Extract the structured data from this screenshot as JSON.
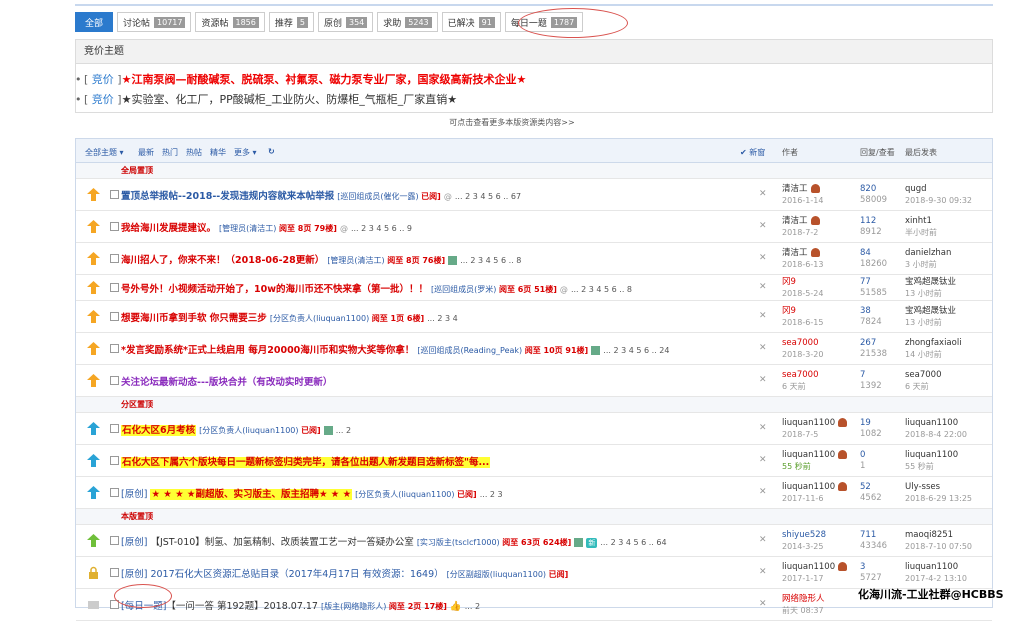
{
  "filters": [
    {
      "label": "全部",
      "count": ""
    },
    {
      "label": "讨论帖",
      "count": "10717"
    },
    {
      "label": "资源帖",
      "count": "1856"
    },
    {
      "label": "推荐",
      "count": "5"
    },
    {
      "label": "原创",
      "count": "354"
    },
    {
      "label": "求助",
      "count": "5243"
    },
    {
      "label": "已解决",
      "count": "91"
    },
    {
      "label": "每日一题",
      "count": "1787"
    }
  ],
  "announcement": {
    "header": "竞价主题",
    "items": [
      {
        "tag": "竞价",
        "text": "★江南泵阀—耐酸碱泵、脱硫泵、衬氟泵、磁力泵专业厂家，国家级高新技术企业★"
      },
      {
        "tag": "竞价",
        "text": "★实验室、化工厂，PP酸碱柜_工业防火、防爆柜_气瓶柜_厂家直销★"
      }
    ]
  },
  "more_link": "可点击查看更多本版资源类内容>>",
  "toolbar": {
    "all": "全部主题",
    "latest": "最新",
    "hot": "热门",
    "hotpost": "热帖",
    "digest": "精华",
    "more": "更多",
    "new_window": "新窗",
    "author_col": "作者",
    "reply_col": "回复/查看",
    "last_col": "最后发表"
  },
  "sections": {
    "global": "全局置顶",
    "district": "分区置顶",
    "board": "本版置顶"
  },
  "rows": [
    {
      "type_tag": "",
      "title": "置顶总举报帖--2018--发现违规内容就来本帖举报",
      "meta": "[巡回组成员(催化一露)",
      "meta_red": "已阅]",
      "pages": "... 2 3 4 5 6 .. 67",
      "author": "清洁工",
      "author_date": "2016-1-14",
      "replies": "820",
      "views": "58009",
      "last_user": "qugd",
      "last_time": "2018-9-30 09:32"
    },
    {
      "type_tag": "",
      "title": "我给海川发展提建议。",
      "meta": "[管理员(清洁工)",
      "meta_red": "阅至 8页 79楼]",
      "pages": "... 2 3 4 5 6 .. 9",
      "author": "清洁工",
      "author_date": "2018-7-2",
      "replies": "112",
      "views": "8912",
      "last_user": "xinht1",
      "last_time": "半小时前"
    },
    {
      "type_tag": "",
      "title": "海川招人了，你来不来！（2018-06-28更新）",
      "meta": "[管理员(清洁工)",
      "meta_red": "阅至 8页 76楼]",
      "pages": "... 2 3 4 5 6 .. 8",
      "author": "清洁工",
      "author_date": "2018-6-13",
      "replies": "84",
      "views": "18260",
      "last_user": "danielzhan",
      "last_time": "3 小时前"
    },
    {
      "type_tag": "",
      "title": "号外号外！小视频活动开始了，10w的海川币还不快来拿（第一批）！！",
      "meta": "[巡回组成员(罗米)",
      "meta_red": "阅至 6页 51楼]",
      "pages": "... 2 3 4 5 6 .. 8",
      "author": "冈9",
      "author_date": "2018-5-24",
      "replies": "77",
      "views": "51585",
      "last_user": "宝鸡超晟钛业",
      "last_time": "13 小时前"
    },
    {
      "type_tag": "",
      "title": "想要海川币拿到手软 你只需要三步",
      "meta": "[分区负责人(liuquan1100)",
      "meta_red": "阅至 1页 6楼]",
      "pages": "... 2 3 4",
      "author": "冈9",
      "author_date": "2018-6-15",
      "replies": "38",
      "views": "7824",
      "last_user": "宝鸡超晟钛业",
      "last_time": "13 小时前"
    },
    {
      "type_tag": "",
      "title": "*发言奖励系统*正式上线启用 每月20000海川币和实物大奖等你拿！",
      "meta": "[巡回组成员(Reading_Peak)",
      "meta_red": "阅至 10页 91楼]",
      "pages": "... 2 3 4 5 6 .. 24",
      "author": "sea7000",
      "author_date": "2018-3-20",
      "replies": "267",
      "views": "21538",
      "last_user": "zhongfaxiaoli",
      "last_time": "14 小时前"
    },
    {
      "type_tag": "",
      "title": "关注论坛最新动态---版块合并（有改动实时更新）",
      "meta": "",
      "meta_red": "",
      "pages": "",
      "author": "sea7000",
      "author_date": "6 天前",
      "replies": "7",
      "views": "1392",
      "last_user": "sea7000",
      "last_time": "6 天前"
    },
    {
      "type_tag": "",
      "title": "石化大区6月考核",
      "meta": "[分区负责人(liuquan1100)",
      "meta_red": "已阅]",
      "pages": "... 2",
      "author": "liuquan1100",
      "author_date": "2018-7-5",
      "replies": "19",
      "views": "1082",
      "last_user": "liuquan1100",
      "last_time": "2018-8-4 22:00"
    },
    {
      "type_tag": "",
      "title": "石化大区下属六个版块每日一题新标签归类完毕，请各位出题人新发题目选新标签\"每...",
      "meta": "",
      "meta_red": "",
      "pages": "",
      "author": "liuquan1100",
      "author_date": "55 秒前",
      "replies": "0",
      "views": "1",
      "last_user": "liuquan1100",
      "last_time": "55 秒前"
    },
    {
      "type_tag": "[原创]",
      "title": "★ ★ ★ ★副超版、实习版主、版主招聘★ ★ ★",
      "meta": "[分区负责人(liuquan1100)",
      "meta_red": "已阅]",
      "pages": "... 2 3",
      "author": "liuquan1100",
      "author_date": "2017-11-6",
      "replies": "52",
      "views": "4562",
      "last_user": "Uly-sses",
      "last_time": "2018-6-29 13:25"
    },
    {
      "type_tag": "[原创]",
      "title": "【JST-010】制氢、加氢精制、改质装置工艺一对一答疑办公室",
      "meta": "[实习版主(tsclcf1000)",
      "meta_red": "阅至 63页 624楼]",
      "pages": "... 2 3 4 5 6 .. 64",
      "author": "shiyue528",
      "author_date": "2014-3-25",
      "replies": "711",
      "views": "43346",
      "last_user": "maoqi8251",
      "last_time": "2018-7-10 07:50"
    },
    {
      "type_tag": "[原创]",
      "title": "2017石化大区资源汇总贴目录（2017年4月17日 有效资源：1649）",
      "meta": "[分区副超版(liuquan1100)",
      "meta_red": "已阅]",
      "pages": "",
      "author": "liuquan1100",
      "author_date": "2017-1-17",
      "replies": "3",
      "views": "5727",
      "last_user": "liuquan1100",
      "last_time": "2017-4-2 13:10"
    },
    {
      "type_tag": "[每日一题]",
      "title": "【一问一答 第192题】2018.07.17",
      "meta": "[版主(网络隐形人)",
      "meta_red": "阅至 2页 17楼]",
      "pages": "... 2",
      "author": "网络隐形人",
      "author_date": "前天 08:37",
      "replies": "",
      "views": "",
      "last_user": "",
      "last_time": ""
    }
  ],
  "watermark": "化海川流-工业社群@HCBBS"
}
